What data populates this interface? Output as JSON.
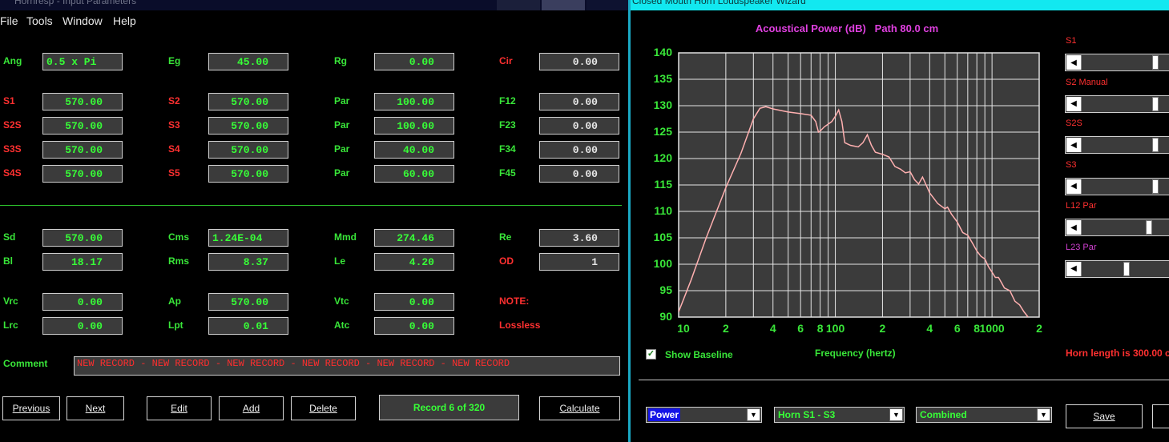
{
  "left_window": {
    "title": "Hornresp - Input Parameters",
    "menu": [
      "File",
      "Tools",
      "Window",
      "Help"
    ],
    "rows": [
      [
        {
          "label": "Ang",
          "lc": "g",
          "value": "0.5 x Pi",
          "align": "left"
        },
        {
          "label": "Eg",
          "lc": "g",
          "value": "45.00"
        },
        {
          "label": "Rg",
          "lc": "g",
          "value": "0.00"
        },
        {
          "label": "Cir",
          "lc": "r",
          "value": "0.00",
          "vc": "white"
        }
      ],
      [
        {
          "label": "S1",
          "lc": "r",
          "value": "570.00"
        },
        {
          "label": "S2",
          "lc": "r",
          "value": "570.00"
        },
        {
          "label": "Par",
          "lc": "g",
          "value": "100.00"
        },
        {
          "label": "F12",
          "lc": "g",
          "value": "0.00",
          "vc": "white"
        }
      ],
      [
        {
          "label": "S2S",
          "lc": "r",
          "value": "570.00"
        },
        {
          "label": "S3",
          "lc": "r",
          "value": "570.00"
        },
        {
          "label": "Par",
          "lc": "g",
          "value": "100.00"
        },
        {
          "label": "F23",
          "lc": "g",
          "value": "0.00",
          "vc": "white"
        }
      ],
      [
        {
          "label": "S3S",
          "lc": "r",
          "value": "570.00"
        },
        {
          "label": "S4",
          "lc": "r",
          "value": "570.00"
        },
        {
          "label": "Par",
          "lc": "g",
          "value": "40.00"
        },
        {
          "label": "F34",
          "lc": "g",
          "value": "0.00",
          "vc": "white"
        }
      ],
      [
        {
          "label": "S4S",
          "lc": "r",
          "value": "570.00"
        },
        {
          "label": "S5",
          "lc": "r",
          "value": "570.00"
        },
        {
          "label": "Par",
          "lc": "g",
          "value": "60.00"
        },
        {
          "label": "F45",
          "lc": "g",
          "value": "0.00",
          "vc": "white"
        }
      ],
      [
        {
          "label": "Sd",
          "lc": "g",
          "value": "570.00"
        },
        {
          "label": "Cms",
          "lc": "g",
          "value": "1.24E-04",
          "align": "left"
        },
        {
          "label": "Mmd",
          "lc": "g",
          "value": "274.46"
        },
        {
          "label": "Re",
          "lc": "g",
          "value": "3.60",
          "vc": "white"
        }
      ],
      [
        {
          "label": "Bl",
          "lc": "g",
          "value": "18.17"
        },
        {
          "label": "Rms",
          "lc": "g",
          "value": "8.37"
        },
        {
          "label": "Le",
          "lc": "g",
          "value": "4.20"
        },
        {
          "label": "OD",
          "lc": "r",
          "value": "1",
          "vc": "white"
        }
      ],
      [
        {
          "label": "Vrc",
          "lc": "g",
          "value": "0.00"
        },
        {
          "label": "Ap",
          "lc": "g",
          "value": "570.00"
        },
        {
          "label": "Vtc",
          "lc": "g",
          "value": "0.00"
        },
        {
          "label": "NOTE:",
          "lc": "r",
          "value": null
        }
      ],
      [
        {
          "label": "Lrc",
          "lc": "g",
          "value": "0.00"
        },
        {
          "label": "Lpt",
          "lc": "g",
          "value": "0.01"
        },
        {
          "label": "Atc",
          "lc": "g",
          "value": "0.00"
        },
        {
          "label": "Lossless",
          "lc": "r",
          "value": null
        }
      ]
    ],
    "comment_label": "Comment",
    "comment_value": "NEW RECORD - NEW RECORD - NEW RECORD - NEW RECORD - NEW RECORD - NEW RECORD",
    "buttons": {
      "previous": "Previous",
      "next": "Next",
      "edit": "Edit",
      "add": "Add",
      "delete": "Delete",
      "calculate": "Calculate"
    },
    "record_status": "Record 6 of 320"
  },
  "right_window": {
    "title": "Closed Mouth Horn Loudspeaker Wizard",
    "sliders": [
      {
        "label": "S1",
        "color": "r",
        "level": 0.83
      },
      {
        "label": "S2 Manual",
        "color": "r",
        "level": 0.83
      },
      {
        "label": "S2S",
        "color": "r",
        "level": 0.83
      },
      {
        "label": "S3",
        "color": "r",
        "level": 0.83
      },
      {
        "label": "L12 Par",
        "color": "r",
        "level": 0.77
      },
      {
        "label": "L23 Par",
        "color": "m",
        "level": 0.55
      }
    ],
    "show_baseline_label": "Show Baseline",
    "show_baseline_checked": true,
    "horn_length": "Horn length is 300.00 c",
    "dropdowns": [
      {
        "value": "Power",
        "highlight": true
      },
      {
        "value": "Horn S1 - S3",
        "highlight": false
      },
      {
        "value": "Combined",
        "highlight": false
      }
    ],
    "save_label": "Save"
  },
  "chart_data": {
    "type": "line",
    "title": "Acoustical Power (dB)   Path 80.0 cm",
    "xlabel": "Frequency (hertz)",
    "ylabel": "",
    "x_scale": "log",
    "xlim": [
      10,
      2000
    ],
    "ylim": [
      90,
      140
    ],
    "grid": true,
    "yticks": [
      140,
      135,
      130,
      125,
      120,
      115,
      110,
      105,
      100,
      95,
      90
    ],
    "xtick_labels": [
      {
        "v": 10,
        "t": "10"
      },
      {
        "v": 20,
        "t": "2"
      },
      {
        "v": 40,
        "t": "4"
      },
      {
        "v": 60,
        "t": "6"
      },
      {
        "v": 80,
        "t": "8"
      },
      {
        "v": 100,
        "t": "100"
      },
      {
        "v": 200,
        "t": "2"
      },
      {
        "v": 400,
        "t": "4"
      },
      {
        "v": 600,
        "t": "6"
      },
      {
        "v": 800,
        "t": "8"
      },
      {
        "v": 1000,
        "t": "1000"
      },
      {
        "v": 2000,
        "t": "2"
      }
    ],
    "series": [
      {
        "color": "#ffb0b0",
        "points": [
          [
            10,
            91
          ],
          [
            12,
            97
          ],
          [
            15,
            105
          ],
          [
            18,
            111
          ],
          [
            20,
            114.5
          ],
          [
            25,
            121
          ],
          [
            30,
            127.5
          ],
          [
            33,
            129.5
          ],
          [
            36,
            129.8
          ],
          [
            40,
            129.4
          ],
          [
            50,
            128.8
          ],
          [
            60,
            128.5
          ],
          [
            70,
            128.2
          ],
          [
            75,
            127
          ],
          [
            78,
            125
          ],
          [
            80,
            125.2
          ],
          [
            85,
            126
          ],
          [
            95,
            127
          ],
          [
            100,
            128
          ],
          [
            105,
            129.2
          ],
          [
            110,
            127
          ],
          [
            115,
            123
          ],
          [
            125,
            122.5
          ],
          [
            140,
            122.2
          ],
          [
            150,
            123
          ],
          [
            160,
            124.5
          ],
          [
            170,
            122.5
          ],
          [
            180,
            121.2
          ],
          [
            200,
            120.8
          ],
          [
            220,
            120.3
          ],
          [
            240,
            118.5
          ],
          [
            260,
            118
          ],
          [
            280,
            117.3
          ],
          [
            300,
            117.5
          ],
          [
            320,
            116
          ],
          [
            340,
            115.2
          ],
          [
            360,
            116.5
          ],
          [
            380,
            115
          ],
          [
            400,
            113.5
          ],
          [
            450,
            111.5
          ],
          [
            500,
            110.5
          ],
          [
            520,
            110.8
          ],
          [
            550,
            109.5
          ],
          [
            600,
            108
          ],
          [
            650,
            106
          ],
          [
            700,
            105.5
          ],
          [
            750,
            104
          ],
          [
            800,
            102.5
          ],
          [
            850,
            101.5
          ],
          [
            900,
            101
          ],
          [
            950,
            99.5
          ],
          [
            1000,
            98.5
          ],
          [
            1050,
            97.5
          ],
          [
            1100,
            97.5
          ],
          [
            1150,
            96.5
          ],
          [
            1200,
            95.5
          ],
          [
            1300,
            95
          ],
          [
            1400,
            93
          ],
          [
            1500,
            92.3
          ],
          [
            1600,
            91
          ],
          [
            1700,
            90
          ]
        ]
      }
    ]
  }
}
